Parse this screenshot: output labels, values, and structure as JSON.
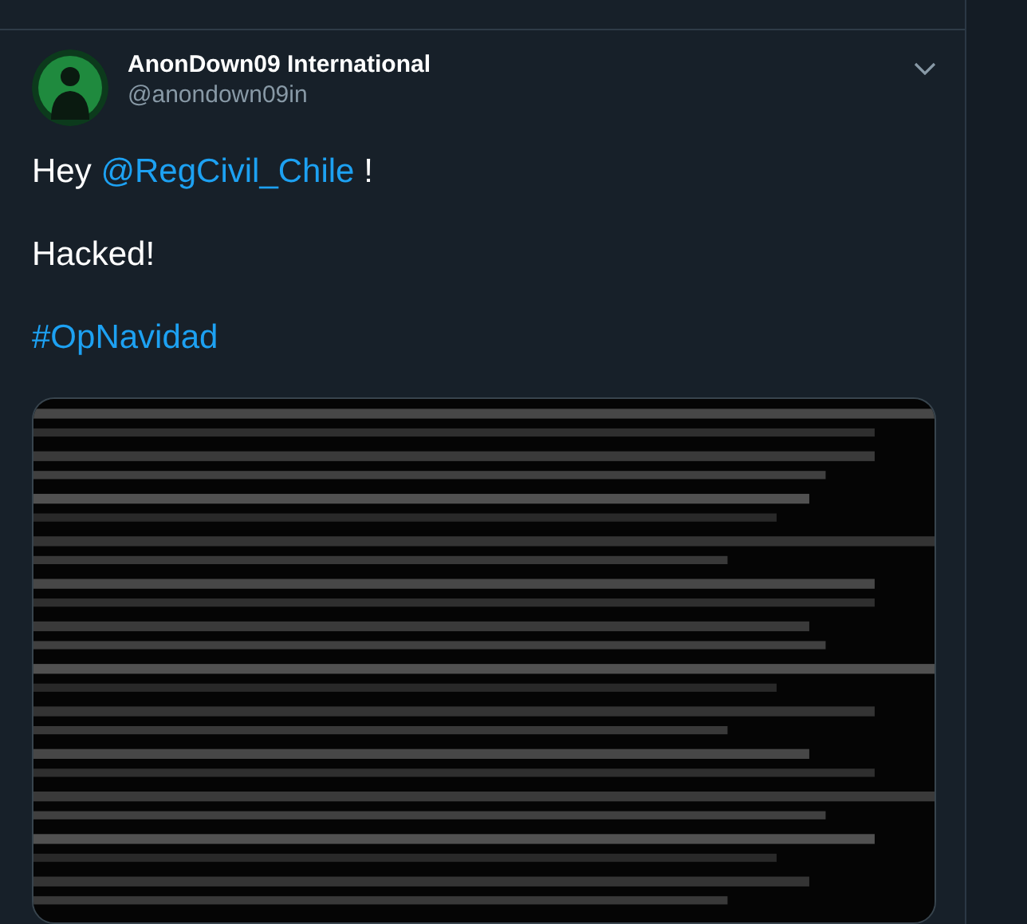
{
  "tweet": {
    "author": {
      "name": "AnonDown09 International",
      "handle": "@anondown09in"
    },
    "lines": [
      {
        "kind": "mention",
        "before": "Hey ",
        "link": "@RegCivil_Chile",
        "after": " !"
      },
      {
        "kind": "plain",
        "text": "Hacked!"
      },
      {
        "kind": "hashtag",
        "text": "#OpNavidad"
      }
    ]
  }
}
